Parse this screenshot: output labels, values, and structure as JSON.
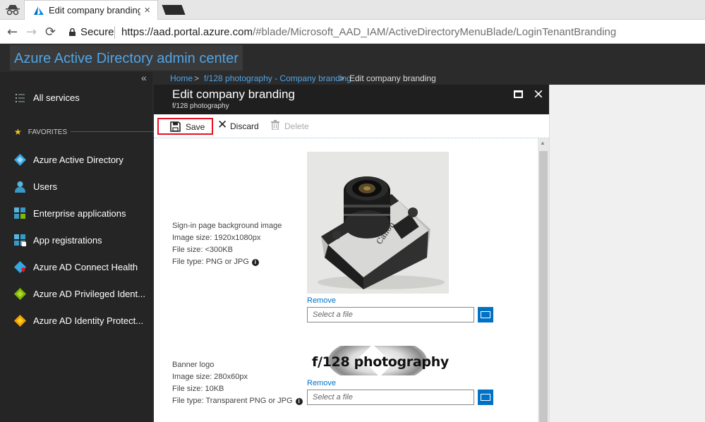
{
  "browser": {
    "tab_title": "Edit company branding - ",
    "tab_close": "×",
    "secure_label": "Secure",
    "url_host": "https://aad.portal.azure.com",
    "url_path": "/#blade/Microsoft_AAD_IAM/ActiveDirectoryMenuBlade/LoginTenantBranding",
    "back": "←",
    "forward": "→",
    "reload": "⟳"
  },
  "portal": {
    "title": "Azure Active Directory admin center"
  },
  "sidebar": {
    "collapse": "«",
    "all_services": "All services",
    "favorites_label": "FAVORITES",
    "items": [
      {
        "label": "Azure Active Directory"
      },
      {
        "label": "Users"
      },
      {
        "label": "Enterprise applications"
      },
      {
        "label": "App registrations"
      },
      {
        "label": "Azure AD Connect Health"
      },
      {
        "label": "Azure AD Privileged Ident..."
      },
      {
        "label": "Azure AD Identity Protect..."
      }
    ]
  },
  "breadcrumb": {
    "home": "Home",
    "sep": ">",
    "branding": "f/128 photography - Company branding",
    "current": "Edit company branding"
  },
  "blade": {
    "title": "Edit company branding",
    "subtitle": "f/128 photography",
    "close": "×"
  },
  "toolbar": {
    "save": "Save",
    "discard": "Discard",
    "delete": "Delete"
  },
  "background_image": {
    "title": "Sign-in page background image",
    "size": "Image size: 1920x1080px",
    "file_size": "File size: <300KB",
    "file_type": "File type: PNG or JPG",
    "remove": "Remove",
    "placeholder": "Select a file"
  },
  "banner_logo": {
    "title": "Banner logo",
    "size": "Image size: 280x60px",
    "file_size": "File size: 10KB",
    "file_type": "File type: Transparent PNG or JPG",
    "remove": "Remove",
    "placeholder": "Select a file",
    "logo_text": "f/128 photography"
  },
  "info_glyph": "i"
}
